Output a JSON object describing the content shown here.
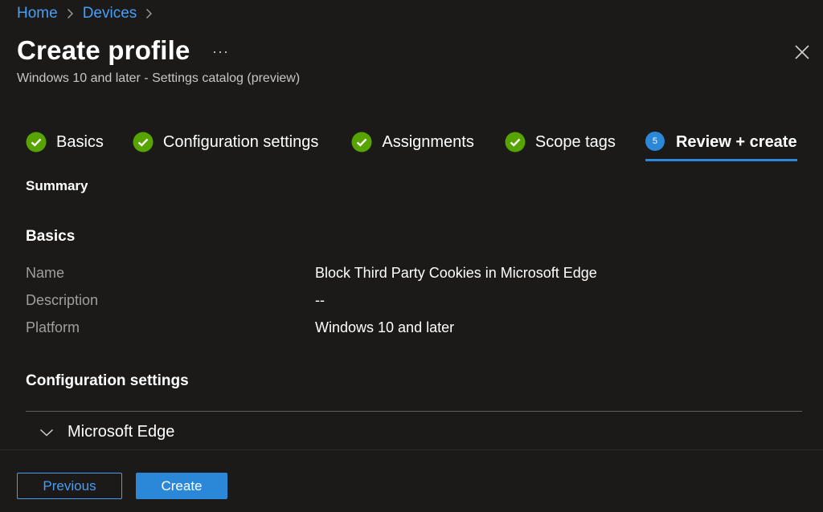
{
  "breadcrumb": {
    "items": [
      "Home",
      "Devices"
    ]
  },
  "header": {
    "title": "Create profile",
    "more": "···",
    "subtitle": "Windows 10 and later - Settings catalog (preview)"
  },
  "tabs": [
    {
      "label": "Basics",
      "state": "complete"
    },
    {
      "label": "Configuration settings",
      "state": "complete"
    },
    {
      "label": "Assignments",
      "state": "complete"
    },
    {
      "label": "Scope tags",
      "state": "complete"
    },
    {
      "label": "Review + create",
      "state": "active",
      "step": "5"
    }
  ],
  "summary": {
    "heading": "Summary",
    "basics_heading": "Basics",
    "rows": [
      {
        "key": "Name",
        "value": "Block Third Party Cookies in Microsoft Edge"
      },
      {
        "key": "Description",
        "value": "--"
      },
      {
        "key": "Platform",
        "value": "Windows 10 and later"
      }
    ],
    "config_heading": "Configuration settings",
    "accordion_label": "Microsoft Edge"
  },
  "footer": {
    "previous_label": "Previous",
    "create_label": "Create"
  },
  "colors": {
    "accent": "#2b88d8",
    "link": "#479ef5",
    "success": "#57a300",
    "background": "#1b1a19"
  }
}
